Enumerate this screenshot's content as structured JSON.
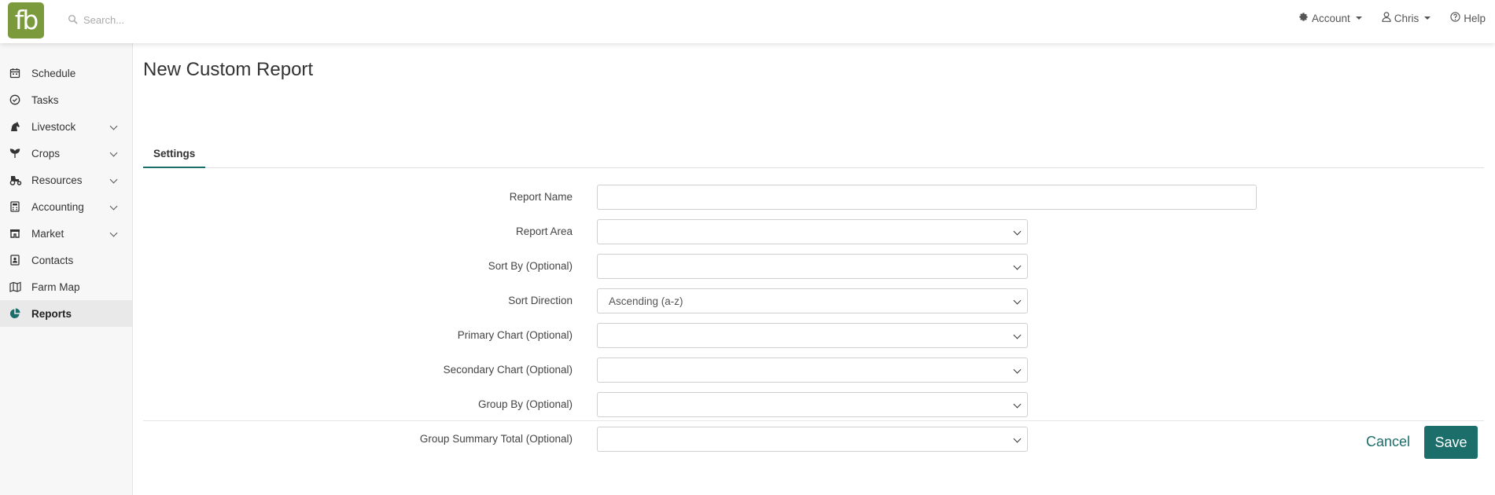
{
  "app": {
    "logo_text": "fb",
    "brand_color": "#7a9a3c",
    "accent_color": "#1b6e6a"
  },
  "search": {
    "placeholder": "Search..."
  },
  "topnav": {
    "account": "Account",
    "user": "Chris",
    "help": "Help"
  },
  "sidebar": {
    "items": [
      {
        "label": "Schedule",
        "icon": "calendar-icon",
        "expandable": false
      },
      {
        "label": "Tasks",
        "icon": "check-circle-icon",
        "expandable": false
      },
      {
        "label": "Livestock",
        "icon": "horse-icon",
        "expandable": true
      },
      {
        "label": "Crops",
        "icon": "seedling-icon",
        "expandable": true
      },
      {
        "label": "Resources",
        "icon": "tractor-icon",
        "expandable": true
      },
      {
        "label": "Accounting",
        "icon": "calculator-icon",
        "expandable": true
      },
      {
        "label": "Market",
        "icon": "store-icon",
        "expandable": true
      },
      {
        "label": "Contacts",
        "icon": "contact-card-icon",
        "expandable": false
      },
      {
        "label": "Farm Map",
        "icon": "map-icon",
        "expandable": false
      },
      {
        "label": "Reports",
        "icon": "pie-chart-icon",
        "expandable": false,
        "active": true
      }
    ]
  },
  "page": {
    "title": "New Custom Report",
    "tab": "Settings"
  },
  "form": {
    "report_name": {
      "label": "Report Name",
      "value": ""
    },
    "report_area": {
      "label": "Report Area",
      "value": ""
    },
    "sort_by": {
      "label": "Sort By (Optional)",
      "value": ""
    },
    "sort_direction": {
      "label": "Sort Direction",
      "value": "Ascending (a-z)"
    },
    "primary_chart": {
      "label": "Primary Chart (Optional)",
      "value": ""
    },
    "secondary_chart": {
      "label": "Secondary Chart (Optional)",
      "value": ""
    },
    "group_by": {
      "label": "Group By (Optional)",
      "value": ""
    },
    "group_summary_total": {
      "label": "Group Summary Total (Optional)",
      "value": ""
    }
  },
  "actions": {
    "cancel": "Cancel",
    "save": "Save"
  }
}
